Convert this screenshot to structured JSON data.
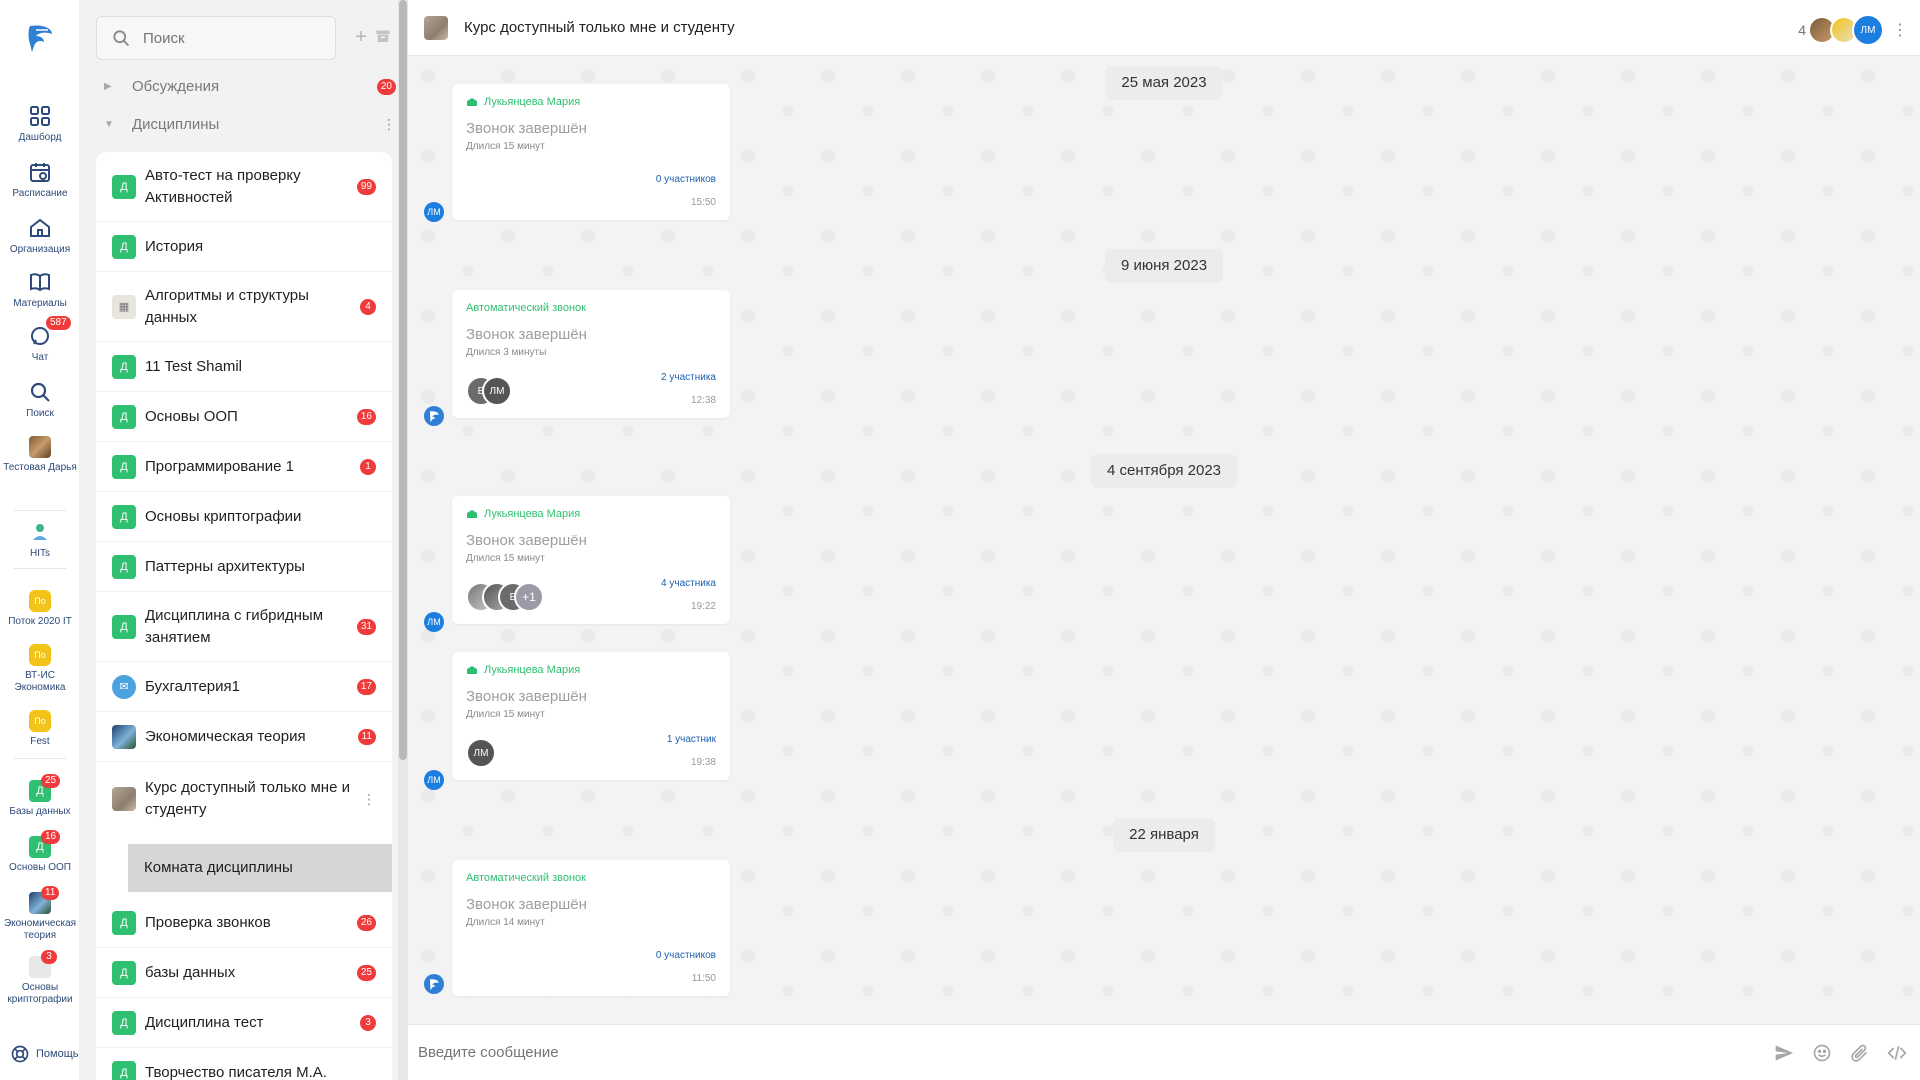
{
  "rail": {
    "items": [
      {
        "label": "Дашборд",
        "icon": "dashboard-icon"
      },
      {
        "label": "Расписание",
        "icon": "calendar-icon"
      },
      {
        "label": "Организация",
        "icon": "home-icon"
      },
      {
        "label": "Материалы",
        "icon": "book-icon"
      },
      {
        "label": "Чат",
        "icon": "chat-icon",
        "badge": "587"
      },
      {
        "label": "Поиск",
        "icon": "search-icon"
      }
    ],
    "workspaces": [
      {
        "label": "Тестовая Дарья"
      },
      {
        "label": "HITs"
      }
    ],
    "streams": [
      {
        "short": "По",
        "label": "Поток 2020 IT"
      },
      {
        "short": "По",
        "label": "ВТ-ИС Экономика"
      },
      {
        "short": "По",
        "label": "Fest"
      }
    ],
    "courses": [
      {
        "short": "Д",
        "label": "Базы данных",
        "badge": "25"
      },
      {
        "short": "Д",
        "label": "Основы ООП",
        "badge": "16"
      },
      {
        "label": "Экономическая теория",
        "badge": "11"
      },
      {
        "label": "Основы криптографии",
        "badge": "3"
      }
    ],
    "help_label": "Помощь"
  },
  "panel": {
    "search_placeholder": "Поиск",
    "groups": {
      "discussions": {
        "label": "Обсуждения",
        "badge": "20"
      },
      "disciplines": {
        "label": "Дисциплины"
      }
    },
    "rows": [
      {
        "avatar": "Д",
        "name": "Авто-тест на проверку Активностей",
        "badge": "99"
      },
      {
        "avatar": "Д",
        "name": "История",
        "badge": ""
      },
      {
        "avatar": "",
        "name": "Алгоритмы и структуры данных",
        "badge": "4"
      },
      {
        "avatar": "Д",
        "name": "11 Test Shamil",
        "badge": ""
      },
      {
        "avatar": "Д",
        "name": "Основы ООП",
        "badge": "16"
      },
      {
        "avatar": "Д",
        "name": "Программирование 1",
        "badge": "1"
      },
      {
        "avatar": "Д",
        "name": "Основы криптографии",
        "badge": ""
      },
      {
        "avatar": "Д",
        "name": "Паттерны архитектуры",
        "badge": ""
      },
      {
        "avatar": "Д",
        "name": "Дисциплина с гибридным занятием",
        "badge": "31"
      },
      {
        "avatar": "",
        "name": "Бухгалтерия1",
        "badge": "17"
      },
      {
        "avatar": "",
        "name": "Экономическая теория",
        "badge": "11"
      },
      {
        "avatar": "",
        "name": "Курс доступный только мне и студенту",
        "badge": ""
      },
      {
        "avatar": "Д",
        "name": "Проверка звонков",
        "badge": "26"
      },
      {
        "avatar": "Д",
        "name": "базы данных",
        "badge": "25"
      },
      {
        "avatar": "Д",
        "name": "Дисциплина тест",
        "badge": "3"
      },
      {
        "avatar": "Д",
        "name": "Творчество писателя М.А.",
        "badge": ""
      }
    ],
    "subroom": "Комната дисциплины"
  },
  "chat": {
    "title": "Курс доступный только мне и студенту",
    "member_count": "4",
    "header_avatar_initials": "ЛМ",
    "composer_placeholder": "Введите сообщение",
    "dates": [
      "25 мая 2023",
      "9 июня 2023",
      "4 сентября 2023",
      "22 января"
    ],
    "calls": [
      {
        "from": "Лукьянцева Мария",
        "title": "Звонок завершён",
        "duration": "Длился 15 минут",
        "participants": "0 участников",
        "time": "15:50",
        "sender": "ЛМ",
        "avatars": []
      },
      {
        "from": "Автоматический звонок",
        "title": "Звонок завершён",
        "duration": "Длился 3 минуты",
        "participants": "2 участника",
        "time": "12:38",
        "sender": "",
        "avatars": [
          "Е",
          "ЛМ"
        ]
      },
      {
        "from": "Лукьянцева Мария",
        "title": "Звонок завершён",
        "duration": "Длился 15 минут",
        "participants": "4 участника",
        "time": "19:22",
        "sender": "ЛМ",
        "avatars": [
          "",
          "",
          "Е",
          "+1"
        ]
      },
      {
        "from": "Лукьянцева Мария",
        "title": "Звонок завершён",
        "duration": "Длился 15 минут",
        "participants": "1 участник",
        "time": "19:38",
        "sender": "ЛМ",
        "avatars": [
          "ЛМ"
        ]
      },
      {
        "from": "Автоматический звонок",
        "title": "Звонок завершён",
        "duration": "Длился 14 минут",
        "participants": "0 участников",
        "time": "11:50",
        "sender": "",
        "avatars": []
      }
    ]
  },
  "colors": {
    "accent_green": "#2fbf71",
    "badge_red": "#ef3b3b",
    "link_blue": "#1c5fb0",
    "avatar_blue": "#1c7fe0",
    "stream_yellow": "#f2c318"
  }
}
